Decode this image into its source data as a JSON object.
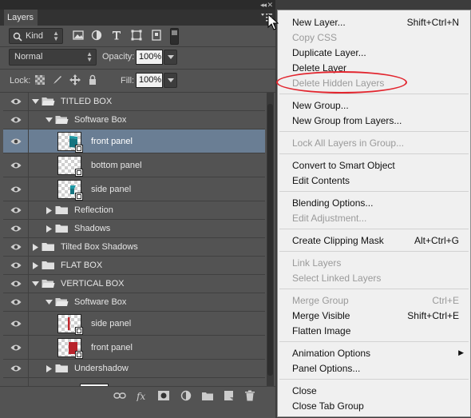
{
  "panel": {
    "tab_title": "Layers",
    "collapse_glyph": "◂◂",
    "close_glyph": "✕",
    "filter": {
      "kind_label": "Kind"
    },
    "blend_mode": "Normal",
    "opacity_label": "Opacity:",
    "opacity_value": "100%",
    "lock_label": "Lock:",
    "fill_label": "Fill:",
    "fill_value": "100%"
  },
  "layers": [
    {
      "name": "TITLED BOX",
      "type": "group",
      "level": 0,
      "expanded": true
    },
    {
      "name": "Software Box",
      "type": "group",
      "level": 1,
      "expanded": true
    },
    {
      "name": "front panel",
      "type": "smart",
      "level": 2,
      "selected": true,
      "thumb": "front-teal"
    },
    {
      "name": "bottom panel",
      "type": "smart",
      "level": 2,
      "thumb": "plain"
    },
    {
      "name": "side panel",
      "type": "smart",
      "level": 2,
      "thumb": "side-teal"
    },
    {
      "name": "Reflection",
      "type": "group",
      "level": 1,
      "expanded": false
    },
    {
      "name": "Shadows",
      "type": "group",
      "level": 1,
      "expanded": false
    },
    {
      "name": "Tilted Box Shadows",
      "type": "group",
      "level": 0,
      "expanded": false
    },
    {
      "name": "FLAT BOX",
      "type": "group",
      "level": 0,
      "expanded": false
    },
    {
      "name": "VERTICAL  BOX",
      "type": "group",
      "level": 0,
      "expanded": true
    },
    {
      "name": "Software Box",
      "type": "group",
      "level": 1,
      "expanded": true
    },
    {
      "name": "side panel",
      "type": "smart",
      "level": 2,
      "thumb": "side-red"
    },
    {
      "name": "front panel",
      "type": "smart",
      "level": 2,
      "thumb": "front-red"
    },
    {
      "name": "Undershadow",
      "type": "group",
      "level": 1,
      "expanded": false
    }
  ],
  "bottom_toolbar": [
    "link-icon",
    "fx-icon",
    "mask-icon",
    "adjustment-icon",
    "folder-icon",
    "new-layer-icon",
    "trash-icon"
  ],
  "menu": {
    "items": [
      {
        "label": "New Layer...",
        "shortcut": "Shift+Ctrl+N",
        "disabled": false
      },
      {
        "label": "Copy CSS",
        "shortcut": "",
        "disabled": true
      },
      {
        "label": "Duplicate Layer...",
        "shortcut": "",
        "disabled": false
      },
      {
        "label": "Delete Layer",
        "shortcut": "",
        "disabled": false
      },
      {
        "label": "Delete Hidden Layers",
        "shortcut": "",
        "disabled": true,
        "highlighted": true
      },
      {
        "sep": true
      },
      {
        "label": "New Group...",
        "shortcut": "",
        "disabled": false
      },
      {
        "label": "New Group from Layers...",
        "shortcut": "",
        "disabled": false
      },
      {
        "sep": true
      },
      {
        "label": "Lock All Layers in Group...",
        "shortcut": "",
        "disabled": true
      },
      {
        "sep": true
      },
      {
        "label": "Convert to Smart Object",
        "shortcut": "",
        "disabled": false
      },
      {
        "label": "Edit Contents",
        "shortcut": "",
        "disabled": false
      },
      {
        "sep": true
      },
      {
        "label": "Blending Options...",
        "shortcut": "",
        "disabled": false
      },
      {
        "label": "Edit Adjustment...",
        "shortcut": "",
        "disabled": true
      },
      {
        "sep": true
      },
      {
        "label": "Create Clipping Mask",
        "shortcut": "Alt+Ctrl+G",
        "disabled": false
      },
      {
        "sep": true
      },
      {
        "label": "Link Layers",
        "shortcut": "",
        "disabled": true
      },
      {
        "label": "Select Linked Layers",
        "shortcut": "",
        "disabled": true
      },
      {
        "sep": true
      },
      {
        "label": "Merge Group",
        "shortcut": "Ctrl+E",
        "disabled": true
      },
      {
        "label": "Merge Visible",
        "shortcut": "Shift+Ctrl+E",
        "disabled": false
      },
      {
        "label": "Flatten Image",
        "shortcut": "",
        "disabled": false
      },
      {
        "sep": true
      },
      {
        "label": "Animation Options",
        "shortcut": "",
        "disabled": false,
        "submenu": true
      },
      {
        "label": "Panel Options...",
        "shortcut": "",
        "disabled": false
      },
      {
        "sep": true
      },
      {
        "label": "Close",
        "shortcut": "",
        "disabled": false
      },
      {
        "label": "Close Tab Group",
        "shortcut": "",
        "disabled": false
      }
    ]
  },
  "colors": {
    "selection": "#6a7e94",
    "panel": "#535353",
    "menu_bg": "#f0f0f0",
    "highlight_ring": "#e2252e",
    "disabled_text": "#9a9a9a"
  }
}
